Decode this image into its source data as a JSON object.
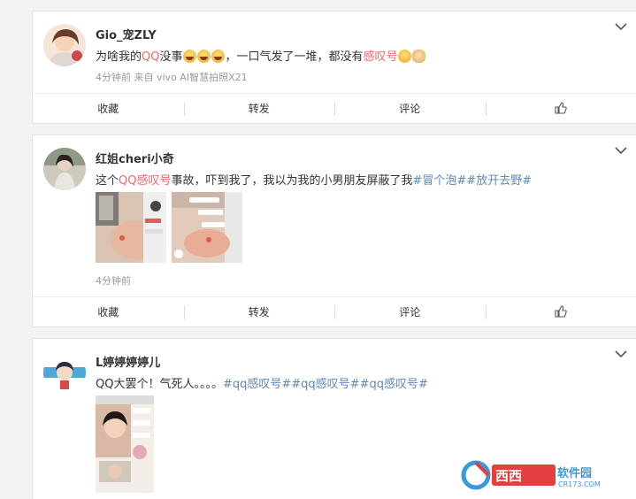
{
  "posts": [
    {
      "username": "Gio_宠ZLY",
      "text_pre": "为啥我的",
      "text_hl1": "QQ",
      "text_mid": "没事",
      "text_post": "，一口气发了一堆，都没有",
      "text_hl2": "感叹号",
      "meta": "4分钟前 来自 vivo AI智慧拍照X21"
    },
    {
      "username": "红姐cheri小奇",
      "text_pre": "这个",
      "text_hl1": "QQ感叹号",
      "text_post": "事故，吓到我了，我以为我的小男朋友屏蔽了我",
      "tag1": "#冒个泡#",
      "tag2": "#放开去野#",
      "meta": "4分钟前"
    },
    {
      "username": "L婷婷婷婷儿",
      "text_pre": "QQ大罢个！气死人。。。。",
      "tag1": "#qq感叹号#",
      "tag2": "#qq感叹号#",
      "tag3": "#qq感叹号#"
    }
  ],
  "actions": {
    "collect": "收藏",
    "repost": "转发",
    "comment": "评论"
  },
  "watermark": {
    "brand": "西西软件园",
    "url": "CR173.COM"
  },
  "icons": [
    "chevron-down-icon",
    "thumbs-up-icon",
    "laugh-emoji-icon",
    "dog-emoji-icon"
  ],
  "colors": {
    "highlight": "#e86b6b",
    "topic": "#5d88bb",
    "meta": "#999999",
    "background": "#f2f2f2"
  }
}
